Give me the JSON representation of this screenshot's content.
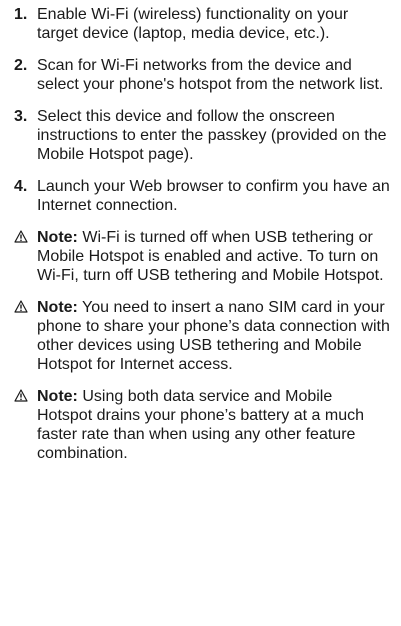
{
  "steps": [
    {
      "number": "1.",
      "text": "Enable Wi-Fi (wireless) functionality on your target device (laptop, media device, etc.)."
    },
    {
      "number": "2.",
      "text": "Scan for Wi-Fi networks from the device and select your phone's hotspot from the network list."
    },
    {
      "number": "3.",
      "text": "Select this device and follow the onscreen instructions to enter the passkey (provided on the Mobile Hotspot page)."
    },
    {
      "number": "4.",
      "text": "Launch your Web browser to confirm you have an Internet connection."
    }
  ],
  "notes": [
    {
      "label": "Note:",
      "text": " Wi-Fi is turned off when USB tethering or Mobile Hotspot is enabled and active. To turn on Wi-Fi, turn off USB tethering and Mobile Hotspot."
    },
    {
      "label": "Note:",
      "text": " You need to insert a nano SIM card in your phone to share your phone’s data connection with other devices using USB tethering and Mobile Hotspot for Internet access."
    },
    {
      "label": "Note:",
      "text": " Using both data service and Mobile Hotspot drains your phone’s battery at a much faster rate than when using any other feature combination."
    }
  ],
  "icons": {
    "note_icon": "warning-triangle-icon",
    "color": "#1a1a1a"
  }
}
